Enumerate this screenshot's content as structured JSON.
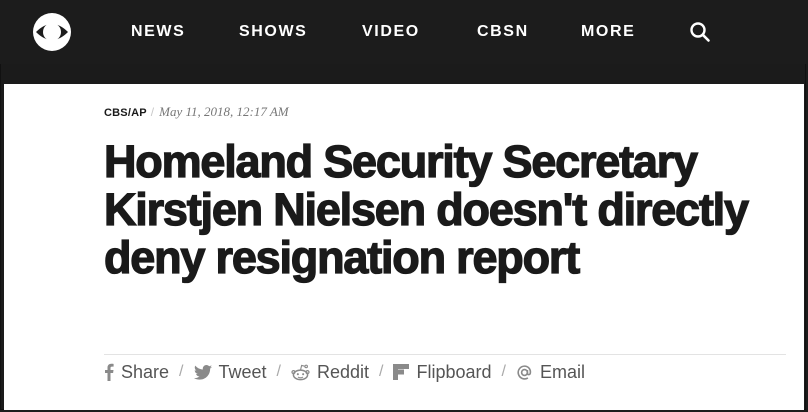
{
  "nav": {
    "logo": "cbs-eye-logo",
    "items": [
      {
        "label": "NEWS"
      },
      {
        "label": "SHOWS"
      },
      {
        "label": "VIDEO"
      },
      {
        "label": "CBSN"
      },
      {
        "label": "MORE"
      }
    ],
    "search_icon": "search-icon"
  },
  "article": {
    "source": "CBS/AP",
    "separator": "/",
    "date": "May 11, 2018, 12:17 AM",
    "headline": "Homeland Security Secretary Kirstjen Nielsen doesn't directly deny resignation report"
  },
  "share": {
    "separator": "/",
    "items": [
      {
        "label": "Share",
        "icon": "facebook-icon"
      },
      {
        "label": "Tweet",
        "icon": "twitter-icon"
      },
      {
        "label": "Reddit",
        "icon": "reddit-icon"
      },
      {
        "label": "Flipboard",
        "icon": "flipboard-icon"
      },
      {
        "label": "Email",
        "icon": "email-icon"
      }
    ]
  },
  "colors": {
    "nav_background": "#1c1c1c",
    "headline": "#1a1a1a",
    "share_text": "#555555"
  }
}
